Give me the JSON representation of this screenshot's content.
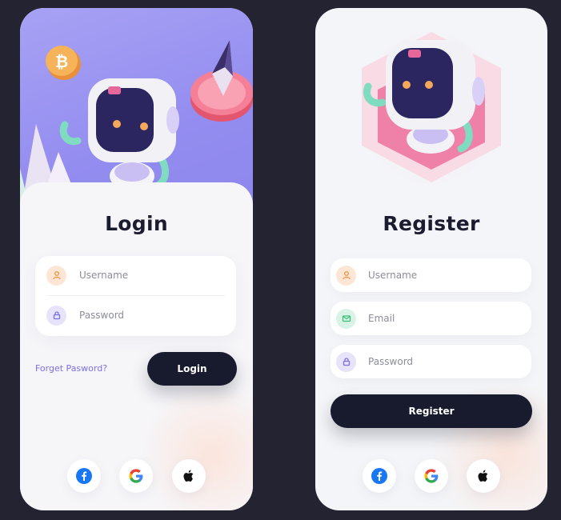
{
  "login": {
    "title": "Login",
    "fields": [
      {
        "placeholder": "Username",
        "icon": "user-icon",
        "icon_color": "#f2994a",
        "chip_color": "#fde6d6"
      },
      {
        "placeholder": "Password",
        "icon": "lock-icon",
        "icon_color": "#7b6fe6",
        "chip_color": "#e6e3fb"
      }
    ],
    "forgot_label": "Forget Pasword?",
    "button_label": "Login"
  },
  "register": {
    "title": "Register",
    "fields": [
      {
        "placeholder": "Username",
        "icon": "user-icon",
        "icon_color": "#f2994a",
        "chip_color": "#fde6d6"
      },
      {
        "placeholder": "Email",
        "icon": "mail-icon",
        "icon_color": "#3fbf7f",
        "chip_color": "#d9f3e6"
      },
      {
        "placeholder": "Password",
        "icon": "lock-icon",
        "icon_color": "#7b6fe6",
        "chip_color": "#e6e3fb"
      }
    ],
    "button_label": "Register"
  },
  "social": [
    "facebook-icon",
    "google-icon",
    "apple-icon"
  ],
  "colors": {
    "background": "#232331",
    "card": "#f4f5f8",
    "hero_purple": "#948df0",
    "dark_button": "#181a2e",
    "link": "#7c6fe6",
    "facebook": "#1877f2"
  }
}
